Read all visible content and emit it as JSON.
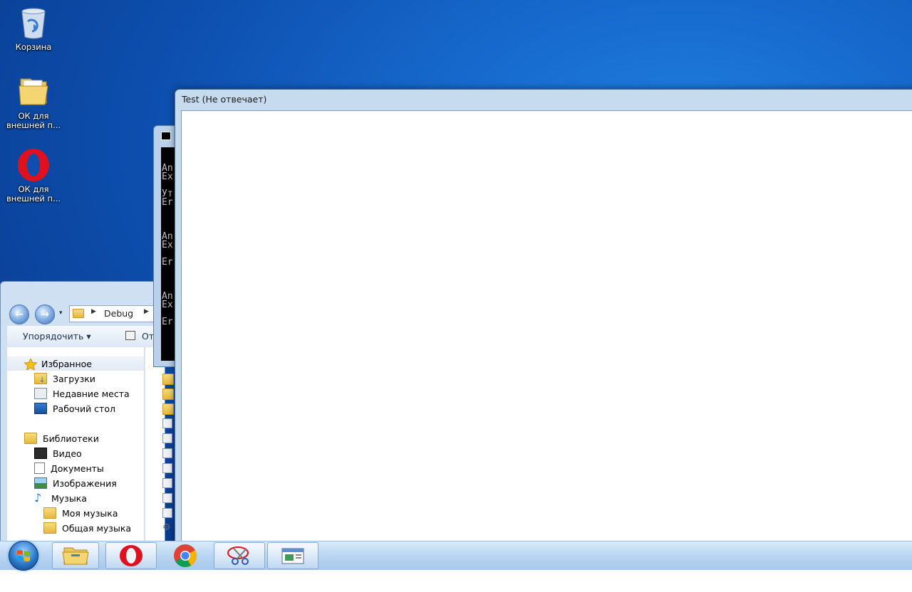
{
  "desktop": {
    "icons": [
      {
        "label": "Корзина"
      },
      {
        "label": "ОК для внешней п..."
      },
      {
        "label": "ОК для внешней п..."
      }
    ]
  },
  "explorer": {
    "address": {
      "path_label": "Debug"
    },
    "toolbar": {
      "organize_label": "Упорядочить ▾",
      "open_label": "От"
    },
    "favorites": {
      "header": "Избранное",
      "items": [
        {
          "label": "Загрузки"
        },
        {
          "label": "Недавние места"
        },
        {
          "label": "Рабочий стол"
        }
      ]
    },
    "libraries": {
      "header": "Библиотеки",
      "items": [
        {
          "label": "Видео"
        },
        {
          "label": "Документы"
        },
        {
          "label": "Изображения"
        },
        {
          "label": "Музыка"
        },
        {
          "label": "Моя музыка"
        },
        {
          "label": "Общая музыка"
        }
      ]
    }
  },
  "console": {
    "lines": [
      "An",
      "Ex",
      "Ут",
      "Er",
      "An",
      "Ex",
      "Er",
      "An",
      "Ex",
      "Er"
    ]
  },
  "test_window": {
    "title": "Test (Не отвечает)"
  },
  "colors": {
    "desktop": "#0d4fae",
    "taskbar": "#bcd7f2",
    "opera_red": "#e0101f"
  }
}
